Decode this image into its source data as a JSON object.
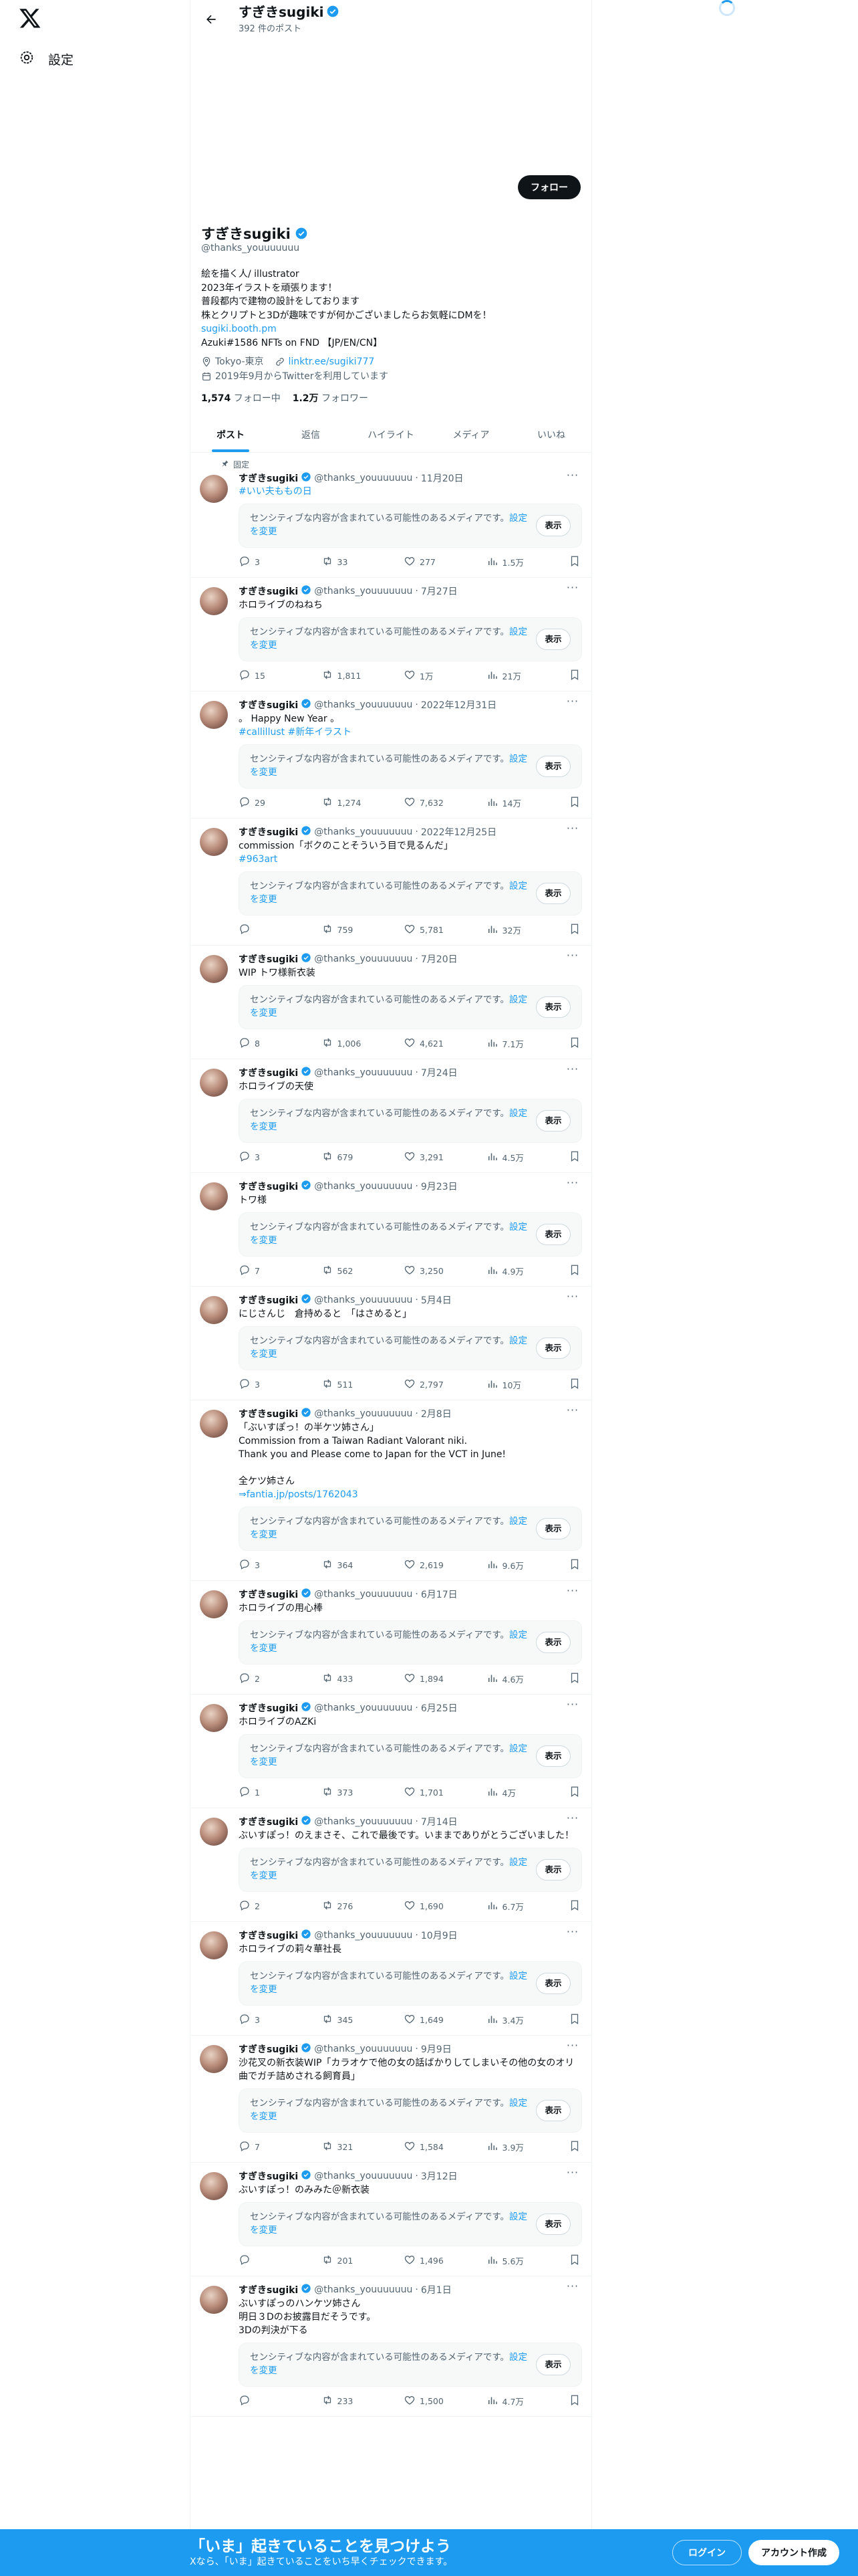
{
  "nav": {
    "settings_label": "設定"
  },
  "header": {
    "name": "すぎきsugiki",
    "post_count": "392 件のポスト"
  },
  "profile": {
    "follow_label": "フォロー",
    "name": "すぎきsugiki",
    "handle": "@thanks_youuuuuuu",
    "bio_lines": [
      "絵を描く人/ illustrator",
      "2023年イラストを頑張ります！",
      "普段都内で建物の設計をしております",
      "株とクリプトと3Dが趣味ですが何かございましたらお気軽にDMを！"
    ],
    "bio_link": "sugiki.booth.pm",
    "bio_last": "Azuki#1586 NFTs on FND 【JP/EN/CN】",
    "location": "Tokyo-東京",
    "website": "linktr.ee/sugiki777",
    "joined": "2019年9月からTwitterを利用しています",
    "following_count": "1,574",
    "following_label": "フォロー中",
    "followers_count": "1.2万",
    "followers_label": "フォロワー"
  },
  "tabs": [
    "ポスト",
    "返信",
    "ハイライト",
    "メディア",
    "いいね"
  ],
  "sensitive": {
    "text": "センシティブな内容が含まれている可能性のあるメディアです。",
    "link": "設定を変更",
    "button": "表示"
  },
  "pinned_label": "固定",
  "tweets": [
    {
      "pinned": true,
      "date": "11月20日",
      "text": "",
      "links": "#いい夫ももの日",
      "reply": "3",
      "rt": "33",
      "like": "277",
      "views": "1.5万"
    },
    {
      "date": "7月27日",
      "text": "ホロライブのねねち",
      "links": "",
      "reply": "15",
      "rt": "1,811",
      "like": "1万",
      "views": "21万"
    },
    {
      "date": "2022年12月31日",
      "text": "。 Happy New Year 。",
      "links": "#callillust #新年イラスト",
      "reply": "29",
      "rt": "1,274",
      "like": "7,632",
      "views": "14万"
    },
    {
      "date": "2022年12月25日",
      "text": "commission「ボクのことそういう目で見るんだ」",
      "links": "#963art",
      "reply": "",
      "rt": "759",
      "like": "5,781",
      "views": "32万"
    },
    {
      "date": "7月20日",
      "text": "WIP トワ様新衣装",
      "links": "",
      "reply": "8",
      "rt": "1,006",
      "like": "4,621",
      "views": "7.1万"
    },
    {
      "date": "7月24日",
      "text": "ホロライブの天使",
      "links": "",
      "reply": "3",
      "rt": "679",
      "like": "3,291",
      "views": "4.5万"
    },
    {
      "date": "9月23日",
      "text": "トワ様",
      "links": "",
      "reply": "7",
      "rt": "562",
      "like": "3,250",
      "views": "4.9万"
    },
    {
      "date": "5月4日",
      "text": "にじさんじ　倉持めると　「はさめると」",
      "links": "",
      "reply": "3",
      "rt": "511",
      "like": "2,797",
      "views": "10万"
    },
    {
      "date": "2月8日",
      "text": "「ぶいすぽっ！の半ケツ姉さん」\nCommission from a Taiwan Radiant Valorant niki.\nThank you and Please come to Japan for the VCT in June!\n\n全ケツ姉さん",
      "links": "⇒fantia.jp/posts/1762043",
      "reply": "3",
      "rt": "364",
      "like": "2,619",
      "views": "9.6万"
    },
    {
      "date": "6月17日",
      "text": "ホロライブの用心棒",
      "links": "",
      "reply": "2",
      "rt": "433",
      "like": "1,894",
      "views": "4.6万"
    },
    {
      "date": "6月25日",
      "text": "ホロライブのAZKi",
      "links": "",
      "reply": "1",
      "rt": "373",
      "like": "1,701",
      "views": "4万"
    },
    {
      "date": "7月14日",
      "text": "ぶいすぽっ！のえまさそ、これで最後です。いままでありがとうございました！",
      "links": "",
      "reply": "2",
      "rt": "276",
      "like": "1,690",
      "views": "6.7万"
    },
    {
      "date": "10月9日",
      "text": "ホロライブの莉々華社長",
      "links": "",
      "reply": "3",
      "rt": "345",
      "like": "1,649",
      "views": "3.4万"
    },
    {
      "date": "9月9日",
      "text": "沙花叉の新衣装WIP「カラオケで他の女の話ばかりしてしまいその他の女のオリ曲でガチ詰めされる飼育員」",
      "links": "",
      "reply": "7",
      "rt": "321",
      "like": "1,584",
      "views": "3.9万"
    },
    {
      "date": "3月12日",
      "text": "ぶいすぽっ！のみみた＠新衣装",
      "links": "",
      "reply": "",
      "rt": "201",
      "like": "1,496",
      "views": "5.6万"
    },
    {
      "date": "6月1日",
      "text": "ぶいすぽっのハンケツ姉さん\n明日３Dのお披露目だそうです。\n3Dの判決が下る",
      "links": "",
      "reply": "",
      "rt": "233",
      "like": "1,500",
      "views": "4.7万"
    }
  ],
  "bottom": {
    "title": "「いま」起きていることを見つけよう",
    "subtitle": "Xなら、「いま」起きていることをいち早くチェックできます。",
    "login": "ログイン",
    "signup": "アカウント作成"
  },
  "colors": {
    "accent": "#1d9bf0",
    "text": "#0f1419",
    "muted": "#536471"
  }
}
